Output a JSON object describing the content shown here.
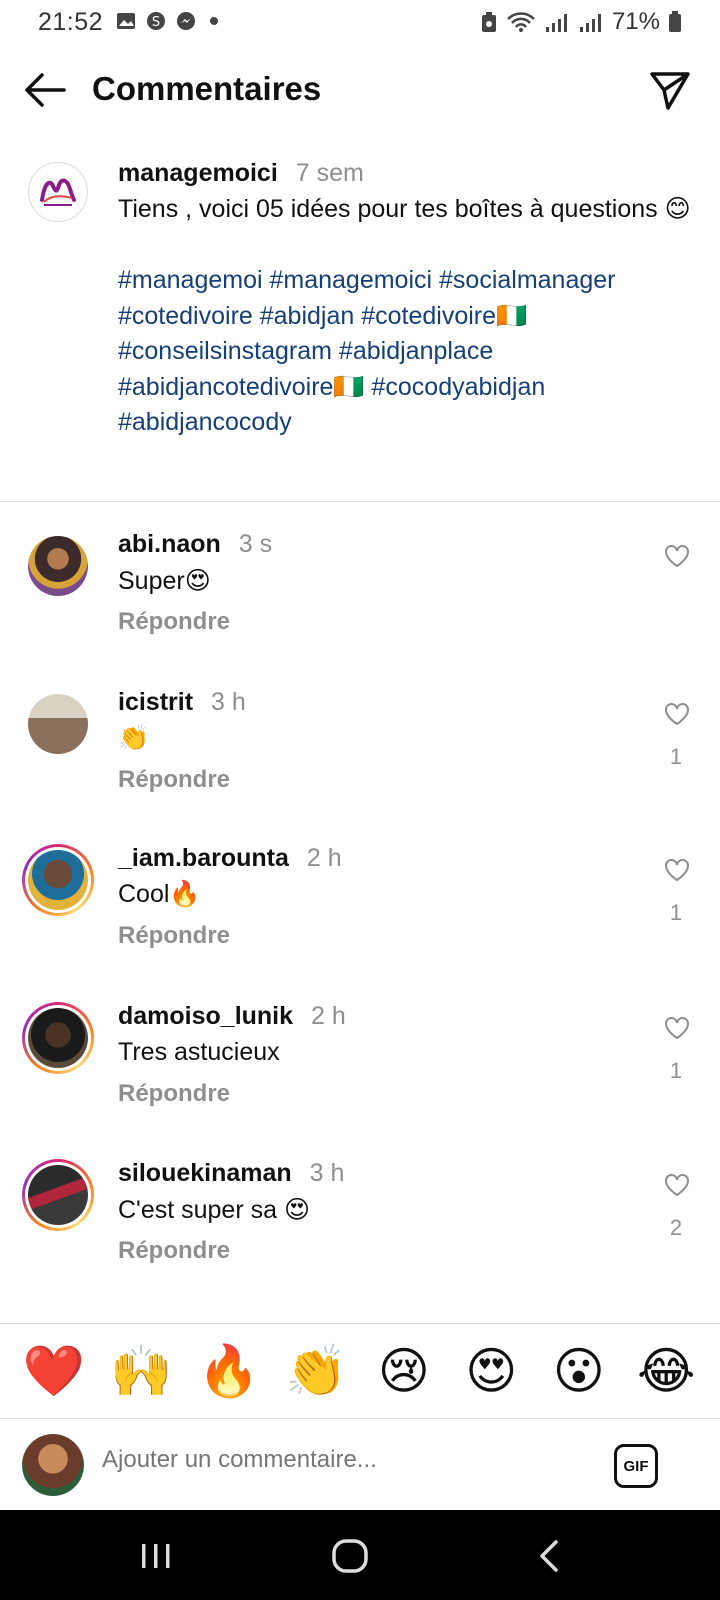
{
  "status_bar": {
    "time": "21:52",
    "battery": "71%"
  },
  "header": {
    "title": "Commentaires"
  },
  "caption": {
    "username": "managemoici",
    "time": "7 sem",
    "text": "Tiens , voici 05 idées pour tes boîtes à questions 😊",
    "hashtags": "#managemoi #managemoici #socialmanager #cotedivoire #abidjan #cotedivoire🇨🇮 #conseilsinstagram #abidjanplace #abidjancotedivoire🇨🇮 #cocodyabidjan #abidjancocody"
  },
  "reply_label": "Répondre",
  "comments": [
    {
      "username": "abi.naon",
      "time": "3 s",
      "text": "Super😍",
      "likes": ""
    },
    {
      "username": "icistrit",
      "time": "3 h",
      "text": "👏",
      "likes": "1"
    },
    {
      "username": "_iam.barounta",
      "time": "2 h",
      "text": "Cool🔥",
      "likes": "1"
    },
    {
      "username": "damoiso_lunik",
      "time": "2 h",
      "text": "Tres astucieux",
      "likes": "1"
    },
    {
      "username": "silouekinaman",
      "time": "3 h",
      "text": "C'est super sa 😍",
      "likes": "2"
    }
  ],
  "emoji_bar": [
    "❤️",
    "🙌",
    "🔥",
    "👏",
    "😢",
    "😍",
    "😮",
    "😂"
  ],
  "input": {
    "placeholder": "Ajouter un commentaire...",
    "gif_label": "GIF"
  },
  "colors": {
    "hashtag": "#163f7a",
    "muted": "#8e8e8e"
  }
}
